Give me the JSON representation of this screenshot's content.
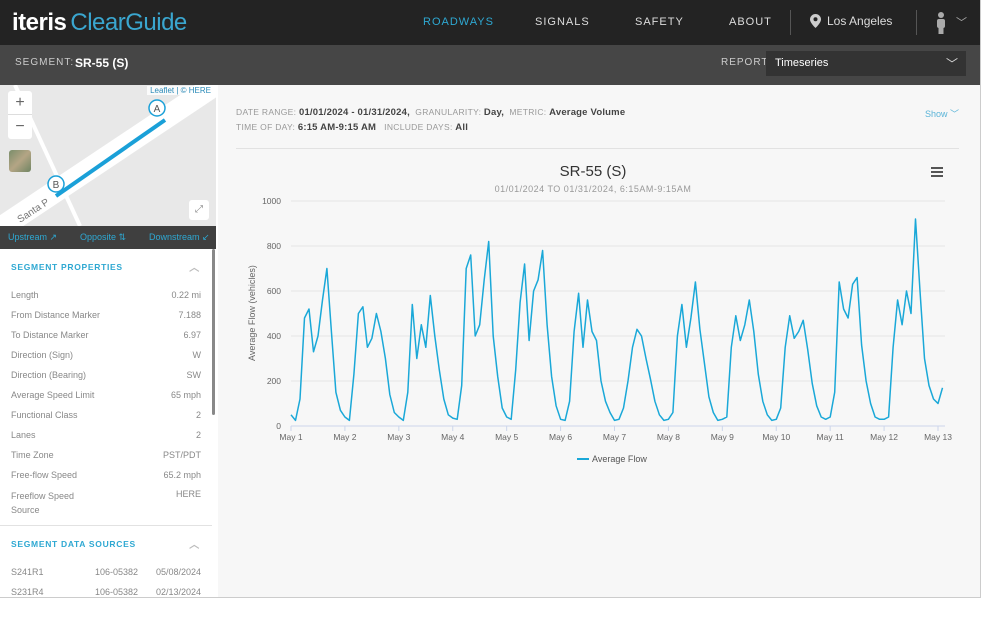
{
  "header": {
    "logo_primary": "iteris",
    "logo_secondary": "ClearGuide",
    "nav": [
      {
        "label": "ROADWAYS",
        "active": true
      },
      {
        "label": "SIGNALS"
      },
      {
        "label": "SAFETY"
      },
      {
        "label": "ABOUT"
      }
    ],
    "location": "Los Angeles",
    "location_icon": "map-pin-icon",
    "user_icon": "person-icon"
  },
  "subheader": {
    "segment_label": "SEGMENT:",
    "segment_value": "SR-55 (S)",
    "report_label": "REPORT:",
    "report_value": "Timeseries"
  },
  "map": {
    "attribution": "Leaflet | © HERE",
    "zoom_in": "+",
    "zoom_out": "−",
    "street_label": "Santa P",
    "marker_a": "A",
    "marker_b": "B",
    "route_color": "#1aa0d8"
  },
  "segment_nav": {
    "upstream": "Upstream ↗",
    "opposite": "Opposite ⇅",
    "downstream": "Downstream ↙"
  },
  "segment_properties": {
    "title": "SEGMENT PROPERTIES",
    "rows": [
      {
        "label": "Length",
        "value": "0.22 mi"
      },
      {
        "label": "From Distance Marker",
        "value": "7.188"
      },
      {
        "label": "To Distance Marker",
        "value": "6.97"
      },
      {
        "label": "Direction (Sign)",
        "value": "W"
      },
      {
        "label": "Direction (Bearing)",
        "value": "SW"
      },
      {
        "label": "Average Speed Limit",
        "value": "65 mph"
      },
      {
        "label": "Functional Class",
        "value": "2"
      },
      {
        "label": "Lanes",
        "value": "2"
      },
      {
        "label": "Time Zone",
        "value": "PST/PDT"
      },
      {
        "label": "Free-flow Speed",
        "value": "65.2 mph"
      },
      {
        "label": "Freeflow Speed Source",
        "value": "HERE"
      }
    ]
  },
  "segment_data_sources": {
    "title": "SEGMENT DATA SOURCES",
    "rows": [
      {
        "id": "S241R1",
        "code": "106-05382",
        "date": "05/08/2024"
      },
      {
        "id": "S231R4",
        "code": "106-05382",
        "date": "02/13/2024"
      }
    ]
  },
  "filters": {
    "date_range_label": "DATE RANGE:",
    "date_range": "01/01/2024 - 01/31/2024",
    "granularity_label": "GRANULARITY:",
    "granularity": "Day",
    "metric_label": "METRIC:",
    "metric": "Average Volume",
    "time_of_day_label": "TIME OF DAY:",
    "time_of_day": "6:15 AM-9:15 AM",
    "include_days_label": "INCLUDE DAYS:",
    "include_days": "All",
    "show": "Show ﹀"
  },
  "chart_data": {
    "type": "line",
    "title": "SR-55 (S)",
    "subtitle": "01/01/2024 TO 01/31/2024, 6:15AM-9:15AM",
    "xlabel": "",
    "ylabel": "Average Flow (vehicles)",
    "ylim": [
      0,
      1000
    ],
    "yticks": [
      0,
      200,
      400,
      600,
      800,
      1000
    ],
    "xticks": [
      "May 1",
      "May 2",
      "May 3",
      "May 4",
      "May 5",
      "May 6",
      "May 7",
      "May 8",
      "May 9",
      "May 10",
      "May 11",
      "May 12",
      "May 13"
    ],
    "x_start": "May 1 00:00",
    "x_interval_hours": 2,
    "grid": "horizontal",
    "legend": "bottom-center",
    "color": "#1aa8d8",
    "series": [
      {
        "name": "Average Flow",
        "values": [
          50,
          25,
          120,
          480,
          520,
          330,
          400,
          560,
          700,
          420,
          150,
          70,
          40,
          25,
          230,
          500,
          530,
          350,
          390,
          500,
          420,
          300,
          140,
          60,
          40,
          25,
          150,
          540,
          300,
          450,
          350,
          580,
          400,
          250,
          120,
          50,
          35,
          30,
          180,
          700,
          760,
          400,
          450,
          650,
          820,
          400,
          220,
          80,
          40,
          30,
          250,
          550,
          720,
          380,
          600,
          650,
          780,
          450,
          220,
          90,
          30,
          25,
          110,
          420,
          590,
          350,
          560,
          420,
          380,
          200,
          110,
          60,
          25,
          30,
          80,
          200,
          350,
          430,
          400,
          300,
          210,
          110,
          50,
          25,
          30,
          60,
          400,
          540,
          350,
          480,
          640,
          430,
          280,
          130,
          60,
          25,
          30,
          40,
          350,
          490,
          380,
          450,
          560,
          420,
          230,
          110,
          50,
          25,
          30,
          80,
          350,
          490,
          390,
          420,
          470,
          340,
          190,
          90,
          40,
          30,
          40,
          150,
          640,
          520,
          480,
          630,
          660,
          360,
          200,
          100,
          40,
          30,
          30,
          40,
          350,
          560,
          450,
          600,
          500,
          920,
          600,
          300,
          180,
          120,
          100,
          170
        ]
      }
    ]
  },
  "chart_menu_icon": "hamburger-menu-icon"
}
